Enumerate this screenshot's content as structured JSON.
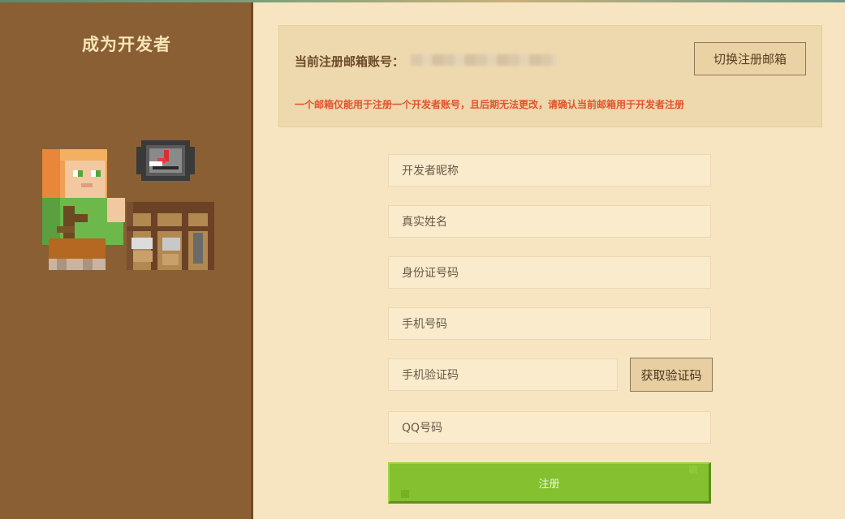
{
  "sidebar": {
    "title": "成为开发者"
  },
  "account": {
    "email_label": "当前注册邮箱账号：",
    "switch_button": "切换注册邮箱",
    "warning": "一个邮箱仅能用于注册一个开发者账号，且后期无法更改，请确认当前邮箱用于开发者注册"
  },
  "form": {
    "nickname_placeholder": "开发者昵称",
    "real_name_placeholder": "真实姓名",
    "id_number_placeholder": "身份证号码",
    "phone_placeholder": "手机号码",
    "sms_code_placeholder": "手机验证码",
    "get_code_button": "获取验证码",
    "qq_placeholder": "QQ号码",
    "register_button": "注册"
  },
  "colors": {
    "sidebar_bg": "#8a5f34",
    "page_bg": "#f6e5c0",
    "warning_text": "#e0542e",
    "register_green": "#84c02f"
  }
}
